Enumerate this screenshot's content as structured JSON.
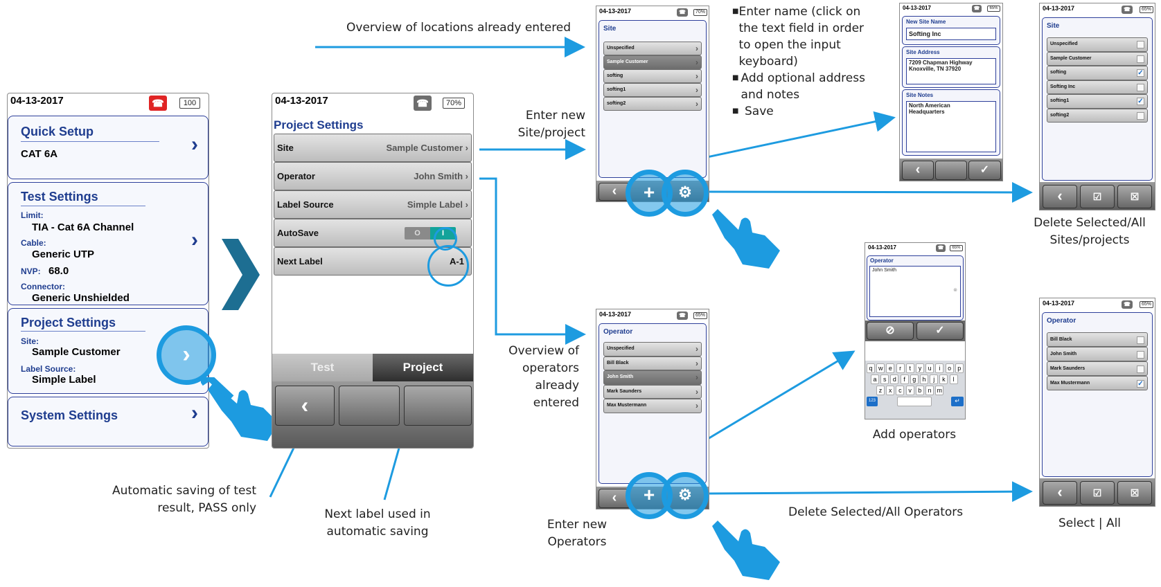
{
  "captions": {
    "overview_locations": "Overview of locations already entered",
    "enter_site_1": "Enter new",
    "enter_site_2": "Site/project",
    "bullets": [
      "Enter name (click on the text field in order to open the input keyboard)",
      "Add optional address and notes",
      "Save"
    ],
    "delete_sites_1": "Delete Selected/All",
    "delete_sites_2": "Sites/projects",
    "overview_ops": [
      "Overview of",
      "operators",
      "already",
      "entered"
    ],
    "add_operators": "Add operators",
    "delete_ops": "Delete Selected/All Operators",
    "select_all": "Select  |  All",
    "enter_ops": [
      "Enter new",
      "Operators"
    ],
    "autosave_note": [
      "Automatic saving of test",
      "result, PASS only"
    ],
    "nextlabel_note": [
      "Next label used in",
      "automatic saving"
    ]
  },
  "main": {
    "date": "04-13-2017",
    "battery": "100",
    "quick_setup": {
      "title": "Quick Setup",
      "value": "CAT 6A"
    },
    "test_settings": {
      "title": "Test Settings",
      "limit_label": "Limit:",
      "limit": "TIA - Cat 6A Channel",
      "cable_label": "Cable:",
      "cable": "Generic UTP",
      "nvp_label": "NVP:",
      "nvp": "68.0",
      "conn_label": "Connector:",
      "conn": "Generic Unshielded"
    },
    "project_settings": {
      "title": "Project Settings",
      "site_label": "Site:",
      "site": "Sample Customer",
      "label_label": "Label Source:",
      "label": "Simple Label"
    },
    "system_settings": {
      "title": "System Settings"
    }
  },
  "project": {
    "date": "04-13-2017",
    "battery": "70%",
    "title": "Project Settings",
    "rows": [
      {
        "label": "Site",
        "value": "Sample Customer"
      },
      {
        "label": "Operator",
        "value": "John Smith"
      },
      {
        "label": "Label Source",
        "value": "Simple Label"
      },
      {
        "label": "AutoSave",
        "value": ""
      },
      {
        "label": "Next Label",
        "value": "A-1"
      }
    ],
    "toggle_off": "O",
    "toggle_on": "I",
    "tab_test": "Test",
    "tab_project": "Project"
  },
  "site_list": {
    "date": "04-13-2017",
    "battery": "70%",
    "title": "Site",
    "items": [
      "Unspecified",
      "Sample Customer",
      "softing",
      "softing1",
      "softing2"
    ]
  },
  "new_site": {
    "date": "04-13-2017",
    "battery": "65%",
    "name_label": "New Site Name",
    "name": "Softing Inc",
    "addr_label": "Site Address",
    "addr1": "7209 Chapman Highway",
    "addr2": "Knoxville, TN 37920",
    "notes_label": "Site Notes",
    "notes1": "North American",
    "notes2": "Headquarters"
  },
  "site_select": {
    "date": "04-13-2017",
    "battery": "65%",
    "title": "Site",
    "items": [
      "Unspecified",
      "Sample Customer",
      "softing",
      "Softing Inc",
      "softing1",
      "softing2"
    ],
    "checked": [
      false,
      false,
      true,
      false,
      true,
      false
    ]
  },
  "operator_list": {
    "date": "04-13-2017",
    "battery": "65%",
    "title": "Operator",
    "items": [
      "Unspecified",
      "Bill Black",
      "John Smith",
      "Mark Saunders",
      "Max Mustermann"
    ]
  },
  "operator_input": {
    "date": "04-13-2017",
    "battery": "65%",
    "title": "Operator",
    "value": "John Smith",
    "keys1": [
      "q",
      "w",
      "e",
      "r",
      "t",
      "y",
      "u",
      "i",
      "o",
      "p"
    ],
    "keys2": [
      "a",
      "s",
      "d",
      "f",
      "g",
      "h",
      "j",
      "k",
      "l"
    ],
    "keys3": [
      "z",
      "x",
      "c",
      "v",
      "b",
      "n",
      "m"
    ],
    "key123": "123"
  },
  "operator_select": {
    "date": "04-13-2017",
    "battery": "65%",
    "title": "Operator",
    "items": [
      "Bill Black",
      "John Smith",
      "Mark Saunders",
      "Max Mustermann"
    ],
    "checked": [
      false,
      false,
      false,
      true
    ]
  },
  "colors": {
    "accent": "#1d9be0",
    "frame": "#2d3f9a",
    "title": "#1f3d8f"
  }
}
